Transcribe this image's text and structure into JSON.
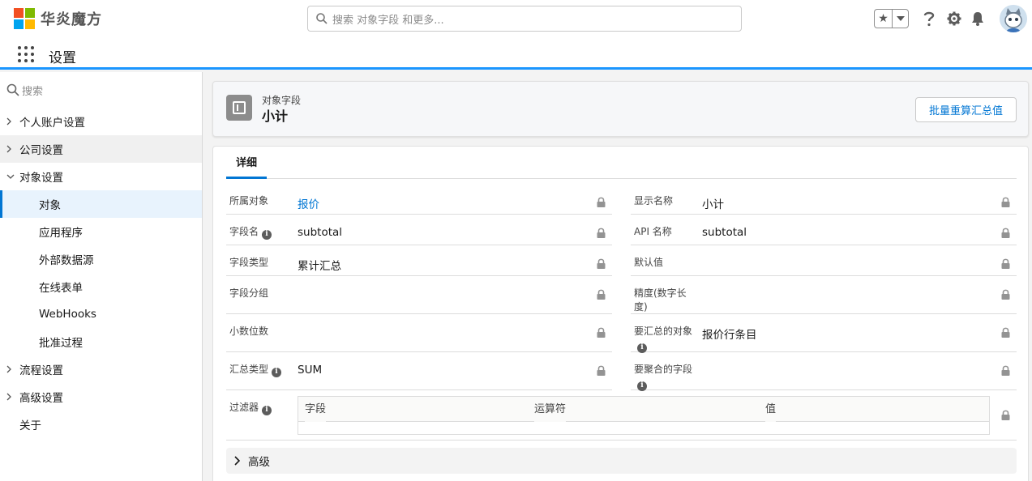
{
  "brand": {
    "name": "华炎魔方",
    "colors": [
      "#f25022",
      "#7fba00",
      "#00a4ef",
      "#ffb900"
    ]
  },
  "search": {
    "placeholder": "搜索 对象字段 和更多..."
  },
  "app": {
    "title": "设置"
  },
  "sidebar": {
    "search_placeholder": "搜索",
    "items": [
      {
        "label": "个人账户设置",
        "expanded": false
      },
      {
        "label": "公司设置",
        "expanded": false
      },
      {
        "label": "对象设置",
        "expanded": true
      },
      {
        "label": "流程设置",
        "expanded": false
      },
      {
        "label": "高级设置",
        "expanded": false
      },
      {
        "label": "关于"
      }
    ],
    "sub_items": [
      "对象",
      "应用程序",
      "外部数据源",
      "在线表单",
      "WebHooks",
      "批准过程"
    ],
    "active_sub": "对象"
  },
  "header": {
    "subtitle": "对象字段",
    "title": "小计",
    "recalc_button": "批量重算汇总值"
  },
  "tabs": {
    "detail": "详细"
  },
  "fields": {
    "object_label": "所属对象",
    "object_value": "报价",
    "display_name_label": "显示名称",
    "display_name_value": "小计",
    "field_name_label": "字段名",
    "field_name_value": "subtotal",
    "api_name_label": "API 名称",
    "api_name_value": "subtotal",
    "field_type_label": "字段类型",
    "field_type_value": "累计汇总",
    "default_label": "默认值",
    "group_label": "字段分组",
    "precision_label": "精度(数字长度)",
    "scale_label": "小数位数",
    "summary_object_label": "要汇总的对象",
    "summary_object_value": "报价行条目",
    "summary_type_label": "汇总类型",
    "summary_type_value": "SUM",
    "summary_field_label": "要聚合的字段",
    "filters_label": "过滤器"
  },
  "filter_table": {
    "columns": [
      "字段",
      "运算符",
      "值"
    ]
  },
  "advanced": {
    "label": "高级"
  },
  "theme": {
    "accent": "#0176d3",
    "bar": "#1b96ff"
  }
}
